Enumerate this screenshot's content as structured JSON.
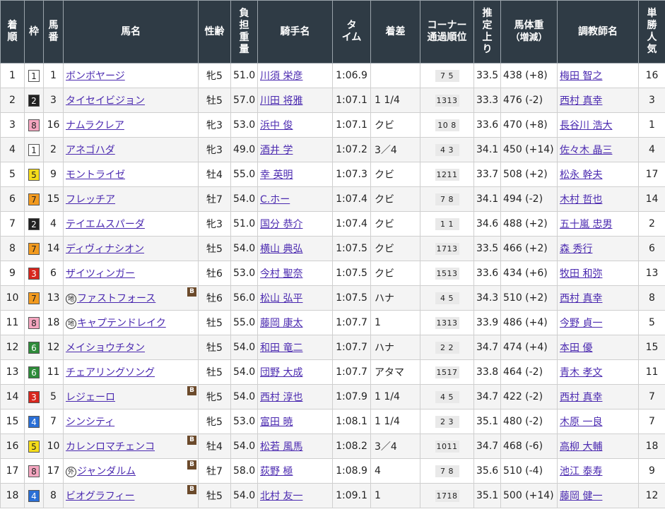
{
  "headers": {
    "finish": [
      "着",
      "順"
    ],
    "waku": "枠",
    "num": [
      "馬",
      "番"
    ],
    "horse": "馬名",
    "sexage": "性齢",
    "weight": [
      "負",
      "担",
      "重",
      "量"
    ],
    "jockey": "騎手名",
    "time": [
      "タ",
      "イム"
    ],
    "margin": "着差",
    "corner": [
      "コーナー",
      "通過順位"
    ],
    "last3f": [
      "推",
      "定",
      "上",
      "り"
    ],
    "bodyweight": [
      "馬体重",
      "（増減）"
    ],
    "trainer": "調教師名",
    "pop": [
      "単",
      "勝",
      "人",
      "気"
    ]
  },
  "colors": {
    "header_bg": "#2f3b45",
    "link": "#4b2ab0",
    "waku_1": "#ffffff",
    "waku_2": "#222222",
    "waku_3": "#d7261e",
    "waku_4": "#2a6fd6",
    "waku_5": "#f5dc1a",
    "waku_6": "#2e8b3a",
    "waku_7": "#f29a1f",
    "waku_8": "#f5a6c0"
  },
  "rows": [
    {
      "finish": "1",
      "waku": "1",
      "num": "1",
      "mark": "",
      "horse": "ボンボヤージ",
      "blinker": false,
      "sexage": "牝5",
      "weight": "51.0",
      "jockey": "川須 栄彦",
      "time": "1:06.9",
      "margin": "",
      "corner": "7 5",
      "last3f": "33.5",
      "bodyweight": "438 (+8)",
      "trainer": "梅田 智之",
      "pop": "16"
    },
    {
      "finish": "2",
      "waku": "2",
      "num": "3",
      "mark": "",
      "horse": "タイセイビジョン",
      "blinker": false,
      "sexage": "牡5",
      "weight": "57.0",
      "jockey": "川田 将雅",
      "time": "1:07.1",
      "margin": "1 1/4",
      "corner": "1313",
      "last3f": "33.3",
      "bodyweight": "476 (-2)",
      "trainer": "西村 真幸",
      "pop": "3"
    },
    {
      "finish": "3",
      "waku": "8",
      "num": "16",
      "mark": "",
      "horse": "ナムラクレア",
      "blinker": false,
      "sexage": "牝3",
      "weight": "53.0",
      "jockey": "浜中 俊",
      "time": "1:07.1",
      "margin": "クビ",
      "corner": "10 8",
      "last3f": "33.6",
      "bodyweight": "470 (+8)",
      "trainer": "長谷川 浩大",
      "pop": "1"
    },
    {
      "finish": "4",
      "waku": "1",
      "num": "2",
      "mark": "",
      "horse": "アネゴハダ",
      "blinker": false,
      "sexage": "牝3",
      "weight": "49.0",
      "jockey": "酒井 学",
      "time": "1:07.2",
      "margin": "3／4",
      "corner": "4 3",
      "last3f": "34.1",
      "bodyweight": "450 (+14)",
      "trainer": "佐々木 晶三",
      "pop": "4"
    },
    {
      "finish": "5",
      "waku": "5",
      "num": "9",
      "mark": "",
      "horse": "モントライゼ",
      "blinker": false,
      "sexage": "牡4",
      "weight": "55.0",
      "jockey": "幸 英明",
      "time": "1:07.3",
      "margin": "クビ",
      "corner": "1211",
      "last3f": "33.7",
      "bodyweight": "508 (+2)",
      "trainer": "松永 幹夫",
      "pop": "17"
    },
    {
      "finish": "6",
      "waku": "7",
      "num": "15",
      "mark": "",
      "horse": "フレッチア",
      "blinker": false,
      "sexage": "牡7",
      "weight": "54.0",
      "jockey": "C.ホー",
      "time": "1:07.4",
      "margin": "クビ",
      "corner": "7 8",
      "last3f": "34.1",
      "bodyweight": "494 (-2)",
      "trainer": "木村 哲也",
      "pop": "14"
    },
    {
      "finish": "7",
      "waku": "2",
      "num": "4",
      "mark": "",
      "horse": "テイエムスパーダ",
      "blinker": false,
      "sexage": "牝3",
      "weight": "51.0",
      "jockey": "国分 恭介",
      "time": "1:07.4",
      "margin": "クビ",
      "corner": "1 1",
      "last3f": "34.6",
      "bodyweight": "488 (+2)",
      "trainer": "五十嵐 忠男",
      "pop": "2"
    },
    {
      "finish": "8",
      "waku": "7",
      "num": "14",
      "mark": "",
      "horse": "ディヴィナシオン",
      "blinker": false,
      "sexage": "牡5",
      "weight": "54.0",
      "jockey": "横山 典弘",
      "time": "1:07.5",
      "margin": "クビ",
      "corner": "1713",
      "last3f": "33.5",
      "bodyweight": "466 (+2)",
      "trainer": "森 秀行",
      "pop": "6"
    },
    {
      "finish": "9",
      "waku": "3",
      "num": "6",
      "mark": "",
      "horse": "ザイツィンガー",
      "blinker": false,
      "sexage": "牡6",
      "weight": "53.0",
      "jockey": "今村 聖奈",
      "time": "1:07.5",
      "margin": "クビ",
      "corner": "1513",
      "last3f": "33.6",
      "bodyweight": "434 (+6)",
      "trainer": "牧田 和弥",
      "pop": "13"
    },
    {
      "finish": "10",
      "waku": "7",
      "num": "13",
      "mark": "地",
      "horse": "ファストフォース",
      "blinker": true,
      "sexage": "牡6",
      "weight": "56.0",
      "jockey": "松山 弘平",
      "time": "1:07.5",
      "margin": "ハナ",
      "corner": "4 5",
      "last3f": "34.3",
      "bodyweight": "510 (+2)",
      "trainer": "西村 真幸",
      "pop": "8"
    },
    {
      "finish": "11",
      "waku": "8",
      "num": "18",
      "mark": "地",
      "horse": "キャプテンドレイク",
      "blinker": false,
      "sexage": "牡5",
      "weight": "55.0",
      "jockey": "藤岡 康太",
      "time": "1:07.7",
      "margin": "1",
      "corner": "1313",
      "last3f": "33.9",
      "bodyweight": "486 (+4)",
      "trainer": "今野 貞一",
      "pop": "5"
    },
    {
      "finish": "12",
      "waku": "6",
      "num": "12",
      "mark": "",
      "horse": "メイショウチタン",
      "blinker": false,
      "sexage": "牡5",
      "weight": "54.0",
      "jockey": "和田 竜二",
      "time": "1:07.7",
      "margin": "ハナ",
      "corner": "2 2",
      "last3f": "34.7",
      "bodyweight": "474 (+4)",
      "trainer": "本田 優",
      "pop": "15"
    },
    {
      "finish": "13",
      "waku": "6",
      "num": "11",
      "mark": "",
      "horse": "チェアリングソング",
      "blinker": false,
      "sexage": "牡5",
      "weight": "54.0",
      "jockey": "団野 大成",
      "time": "1:07.7",
      "margin": "アタマ",
      "corner": "1517",
      "last3f": "33.8",
      "bodyweight": "464 (-2)",
      "trainer": "青木 孝文",
      "pop": "11"
    },
    {
      "finish": "14",
      "waku": "3",
      "num": "5",
      "mark": "",
      "horse": "レジェーロ",
      "blinker": true,
      "sexage": "牝5",
      "weight": "54.0",
      "jockey": "西村 淳也",
      "time": "1:07.9",
      "margin": "1 1/4",
      "corner": "4 5",
      "last3f": "34.7",
      "bodyweight": "422 (-2)",
      "trainer": "西村 真幸",
      "pop": "7"
    },
    {
      "finish": "15",
      "waku": "4",
      "num": "7",
      "mark": "",
      "horse": "シンシティ",
      "blinker": false,
      "sexage": "牝5",
      "weight": "53.0",
      "jockey": "富田 暁",
      "time": "1:08.1",
      "margin": "1 1/4",
      "corner": "2 3",
      "last3f": "35.1",
      "bodyweight": "480 (-2)",
      "trainer": "木原 一良",
      "pop": "7"
    },
    {
      "finish": "16",
      "waku": "5",
      "num": "10",
      "mark": "",
      "horse": "カレンロマチェンコ",
      "blinker": true,
      "sexage": "牡4",
      "weight": "54.0",
      "jockey": "松若 風馬",
      "time": "1:08.2",
      "margin": "3／4",
      "corner": "1011",
      "last3f": "34.7",
      "bodyweight": "468 (-6)",
      "trainer": "高柳 大輔",
      "pop": "18"
    },
    {
      "finish": "17",
      "waku": "8",
      "num": "17",
      "mark": "外",
      "horse": "ジャンダルム",
      "blinker": true,
      "sexage": "牡7",
      "weight": "58.0",
      "jockey": "荻野 極",
      "time": "1:08.9",
      "margin": "4",
      "corner": "7 8",
      "last3f": "35.6",
      "bodyweight": "510 (-4)",
      "trainer": "池江 泰寿",
      "pop": "9"
    },
    {
      "finish": "18",
      "waku": "4",
      "num": "8",
      "mark": "",
      "horse": "ビオグラフィー",
      "blinker": true,
      "sexage": "牡5",
      "weight": "54.0",
      "jockey": "北村 友一",
      "time": "1:09.1",
      "margin": "1",
      "corner": "1718",
      "last3f": "35.1",
      "bodyweight": "500 (+14)",
      "trainer": "藤岡 健一",
      "pop": "12"
    }
  ],
  "blinker_label": "B"
}
